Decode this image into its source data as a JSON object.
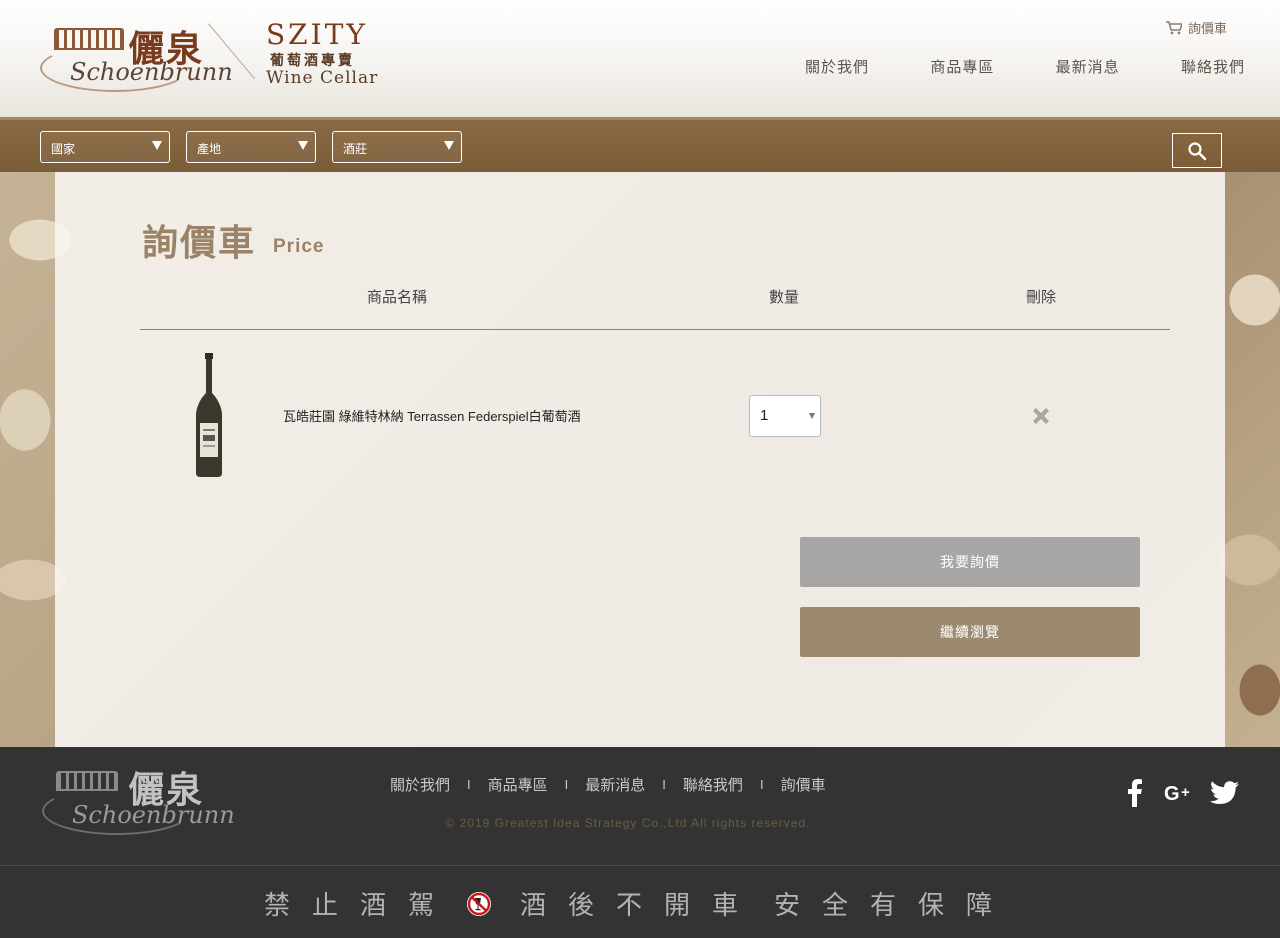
{
  "header": {
    "logo": {
      "brand_cn": "儷泉",
      "brand_script": "Schoenbrunn",
      "partner_name": "SZITY",
      "partner_cn": "葡萄酒專賣",
      "partner_en": "Wine Cellar"
    },
    "cart_link": {
      "label": "詢價車",
      "icon": "cart-icon"
    },
    "nav": [
      {
        "label": "關於我們"
      },
      {
        "label": "商品專區"
      },
      {
        "label": "最新消息"
      },
      {
        "label": "聯絡我們"
      }
    ]
  },
  "filters": {
    "country": {
      "label": "國家"
    },
    "region": {
      "label": "產地"
    },
    "winery": {
      "label": "酒莊"
    },
    "search_icon": "search-icon"
  },
  "main": {
    "title": "詢價車",
    "title_en": "Price",
    "table": {
      "columns": [
        "商品名稱",
        "數量",
        "刪除"
      ],
      "rows": [
        {
          "name": "瓦皓莊園 綠維特林納 Terrassen Federspiel白葡萄酒",
          "quantity": "1",
          "delete_icon": "close-icon"
        }
      ]
    },
    "buttons": {
      "inquire": "我要詢價",
      "continue": "繼續瀏覽"
    }
  },
  "footer": {
    "logo": {
      "brand_cn": "儷泉",
      "brand_script": "Schoenbrunn"
    },
    "nav": [
      {
        "label": "關於我們"
      },
      {
        "label": "商品專區"
      },
      {
        "label": "最新消息"
      },
      {
        "label": "聯絡我們"
      },
      {
        "label": "詢價車"
      }
    ],
    "separator": "I",
    "copyright": "© 2019 Greatest Idea Strategy Co.,Ltd All rights reserved.",
    "social": [
      "facebook-icon",
      "google-plus-icon",
      "twitter-icon"
    ],
    "slogan_left": "禁止酒駕",
    "slogan_mid": "酒後不開車",
    "slogan_right": "安全有保障"
  },
  "colors": {
    "accent_brown": "#9c8a70",
    "filter_bar": "#7a5c38",
    "disabled_button": "#a8a6a4",
    "footer_bg": "#333333"
  }
}
